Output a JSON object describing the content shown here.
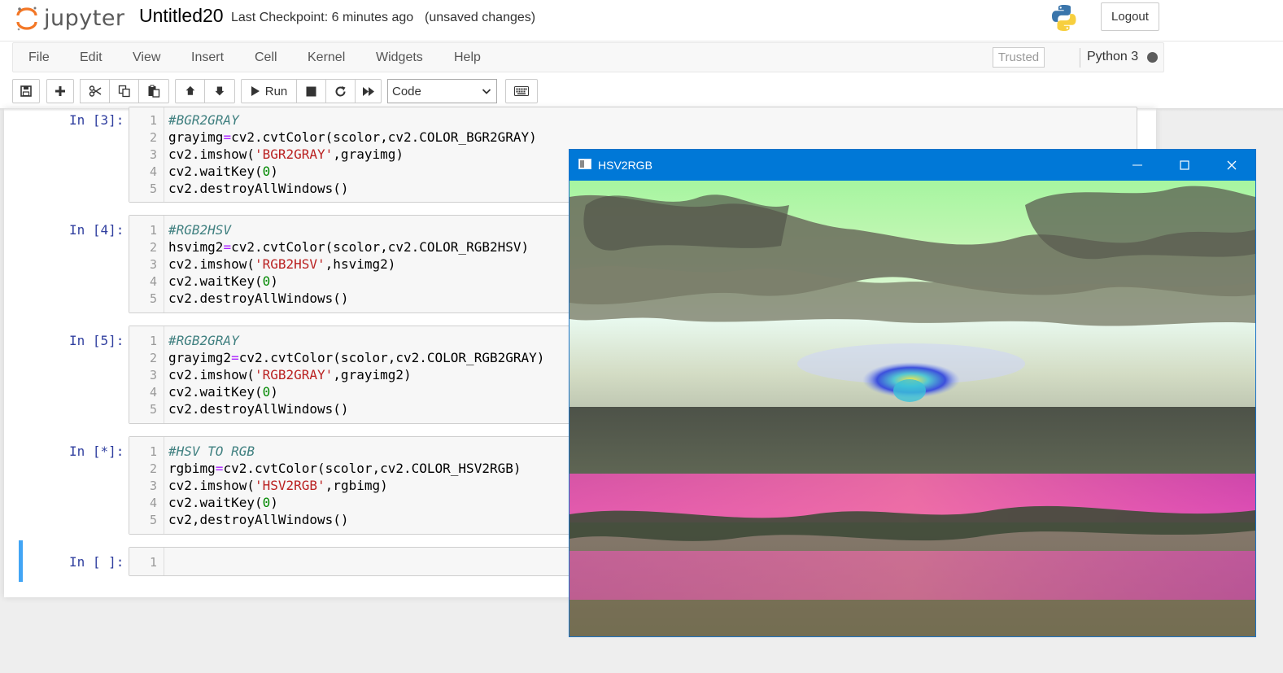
{
  "header": {
    "logo_text": "jupyter",
    "notebook_name": "Untitled20",
    "checkpoint": "Last Checkpoint: 6 minutes ago",
    "unsaved": "(unsaved changes)",
    "logout_label": "Logout"
  },
  "menubar": {
    "items": [
      "File",
      "Edit",
      "View",
      "Insert",
      "Cell",
      "Kernel",
      "Widgets",
      "Help"
    ],
    "trusted_label": "Trusted",
    "kernel_name": "Python 3"
  },
  "toolbar": {
    "run_label": "Run",
    "cell_type": "Code",
    "icons": [
      "save-icon",
      "plus-icon",
      "cut-icon",
      "copy-icon",
      "paste-icon",
      "arrow-up-icon",
      "arrow-down-icon",
      "run-icon",
      "stop-icon",
      "restart-icon",
      "fast-forward-icon",
      "keyboard-icon"
    ]
  },
  "cells": [
    {
      "prompt": "In [3]:",
      "lines": [
        {
          "n": "1",
          "tokens": [
            {
              "t": "#BGR2GRAY",
              "c": "cm"
            }
          ]
        },
        {
          "n": "2",
          "tokens": [
            {
              "t": "grayimg"
            },
            {
              "t": "=",
              "c": "op"
            },
            {
              "t": "cv2.cvtColor(scolor,cv2.COLOR_BGR2GRAY)"
            }
          ]
        },
        {
          "n": "3",
          "tokens": [
            {
              "t": "cv2.imshow("
            },
            {
              "t": "'BGR2GRAY'",
              "c": "st"
            },
            {
              "t": ",grayimg)"
            }
          ]
        },
        {
          "n": "4",
          "tokens": [
            {
              "t": "cv2.waitKey("
            },
            {
              "t": "0",
              "c": "nu"
            },
            {
              "t": ")"
            }
          ]
        },
        {
          "n": "5",
          "tokens": [
            {
              "t": "cv2.destroyAllWindows()"
            }
          ]
        }
      ]
    },
    {
      "prompt": "In [4]:",
      "lines": [
        {
          "n": "1",
          "tokens": [
            {
              "t": "#RGB2HSV",
              "c": "cm"
            }
          ]
        },
        {
          "n": "2",
          "tokens": [
            {
              "t": "hsvimg2"
            },
            {
              "t": "=",
              "c": "op"
            },
            {
              "t": "cv2.cvtColor(scolor,cv2.COLOR_RGB2HSV)"
            }
          ]
        },
        {
          "n": "3",
          "tokens": [
            {
              "t": "cv2.imshow("
            },
            {
              "t": "'RGB2HSV'",
              "c": "st"
            },
            {
              "t": ",hsvimg2)"
            }
          ]
        },
        {
          "n": "4",
          "tokens": [
            {
              "t": "cv2.waitKey("
            },
            {
              "t": "0",
              "c": "nu"
            },
            {
              "t": ")"
            }
          ]
        },
        {
          "n": "5",
          "tokens": [
            {
              "t": "cv2.destroyAllWindows()"
            }
          ]
        }
      ]
    },
    {
      "prompt": "In [5]:",
      "lines": [
        {
          "n": "1",
          "tokens": [
            {
              "t": "#RGB2GRAY",
              "c": "cm"
            }
          ]
        },
        {
          "n": "2",
          "tokens": [
            {
              "t": "grayimg2"
            },
            {
              "t": "=",
              "c": "op"
            },
            {
              "t": "cv2.cvtColor(scolor,cv2.COLOR_RGB2GRAY)"
            }
          ]
        },
        {
          "n": "3",
          "tokens": [
            {
              "t": "cv2.imshow("
            },
            {
              "t": "'RGB2GRAY'",
              "c": "st"
            },
            {
              "t": ",grayimg2)"
            }
          ]
        },
        {
          "n": "4",
          "tokens": [
            {
              "t": "cv2.waitKey("
            },
            {
              "t": "0",
              "c": "nu"
            },
            {
              "t": ")"
            }
          ]
        },
        {
          "n": "5",
          "tokens": [
            {
              "t": "cv2.destroyAllWindows()"
            }
          ]
        }
      ]
    },
    {
      "prompt": "In [*]:",
      "lines": [
        {
          "n": "1",
          "tokens": [
            {
              "t": "#HSV TO RGB",
              "c": "cm"
            }
          ]
        },
        {
          "n": "2",
          "tokens": [
            {
              "t": "rgbimg"
            },
            {
              "t": "=",
              "c": "op"
            },
            {
              "t": "cv2.cvtColor(scolor,cv2.COLOR_HSV2RGB)"
            }
          ]
        },
        {
          "n": "3",
          "tokens": [
            {
              "t": "cv2.imshow("
            },
            {
              "t": "'HSV2RGB'",
              "c": "st"
            },
            {
              "t": ",rgbimg)"
            }
          ]
        },
        {
          "n": "4",
          "tokens": [
            {
              "t": "cv2.waitKey("
            },
            {
              "t": "0",
              "c": "nu"
            },
            {
              "t": ")"
            }
          ]
        },
        {
          "n": "5",
          "tokens": [
            {
              "t": "cv2,destroyAllWindows()"
            }
          ]
        }
      ]
    },
    {
      "prompt": "In [ ]:",
      "lines": [
        {
          "n": "1",
          "tokens": []
        }
      ]
    }
  ],
  "popup": {
    "title": "HSV2RGB",
    "image_description_icon": "window-app-icon"
  }
}
